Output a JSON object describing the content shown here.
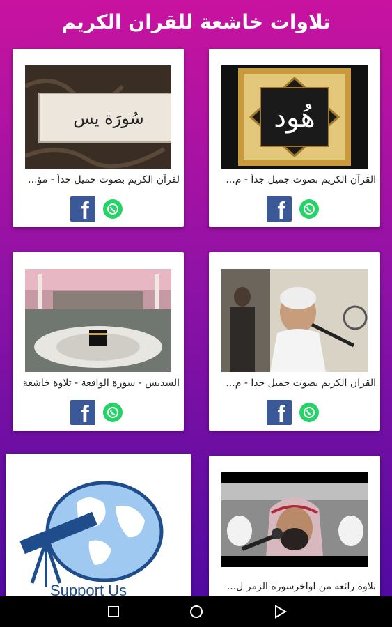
{
  "header": {
    "title": "تلاوات خاشعة للقران الكريم"
  },
  "cards": [
    {
      "caption": "القرآن الكريم بصوت جميل جداً - م...",
      "thumb_text": "هُود",
      "thumb_icon": "surah-hud-calligraphy"
    },
    {
      "caption": "لقرآن الكريم بصوت جميل جداً - مؤ...",
      "thumb_text": "سُورَة يس",
      "thumb_icon": "surah-yasin-calligraphy"
    },
    {
      "caption": "القرآن الكريم بصوت جميل جداً - م...",
      "thumb_icon": "reciter-praying"
    },
    {
      "caption": "السديس - سورة الواقعة - تلاوة خاشعة",
      "thumb_icon": "kaaba-mecca"
    },
    {
      "caption": "تلاوة رائعة من اواخرسورة الزمر ل...",
      "thumb_icon": "reciter-microphone"
    },
    {
      "support_text": "Support Us",
      "icon": "telescope-globe-icon"
    }
  ],
  "share": {
    "facebook_icon": "facebook-icon",
    "whatsapp_icon": "whatsapp-icon"
  },
  "colors": {
    "background_top": "#c8139f",
    "background_bottom": "#4a0aa0",
    "facebook": "#3b5998",
    "whatsapp": "#25d366"
  },
  "navbar": {
    "back_icon": "back-triangle-icon",
    "home_icon": "home-circle-icon",
    "recents_icon": "recents-square-icon"
  }
}
